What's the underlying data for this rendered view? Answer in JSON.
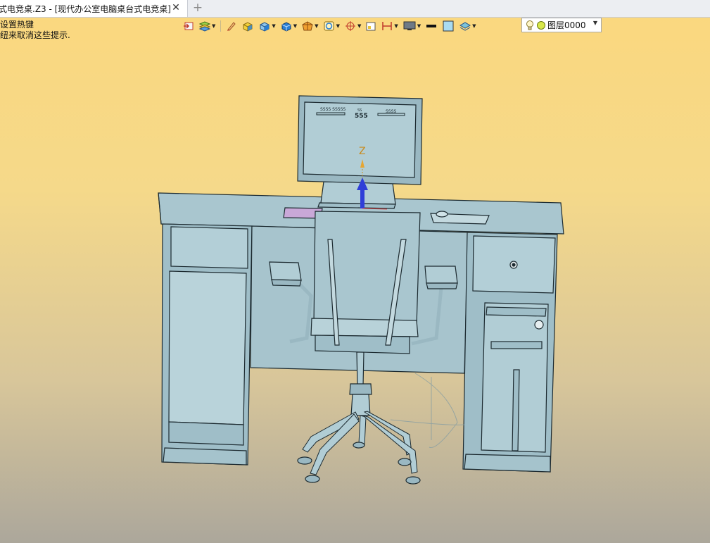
{
  "tabs": [
    {
      "title": "式电竞桌.Z3 - [现代办公室电脑桌台式电竞桌]",
      "active": true
    }
  ],
  "add_tab_symbol": "+",
  "hint_lines": [
    "设置热键",
    "纽来取消这些提示."
  ],
  "toolbar": {
    "icons": [
      "import-icon",
      "layers-icon",
      "pen-icon",
      "solid-box-icon",
      "cube-icon",
      "view-cube-icon",
      "shaded-sphere-icon",
      "target-view-icon",
      "crosshair-icon",
      "frame-icon",
      "dimension-icon",
      "monitor-icon",
      "line-color-icon",
      "fill-color-icon",
      "layer-stack-icon"
    ],
    "layer_value": "图层0000"
  },
  "model": {
    "axis_label": "Z",
    "monitor_text": {
      "left": "SSSS SSSSS",
      "center_top": "SS",
      "center_big": "555",
      "right": "SSSS"
    }
  },
  "colors": {
    "accent": "#2f3fd8",
    "model": "#a9c6cf",
    "edge": "#1c2a30",
    "axis": "#c98a1c"
  }
}
